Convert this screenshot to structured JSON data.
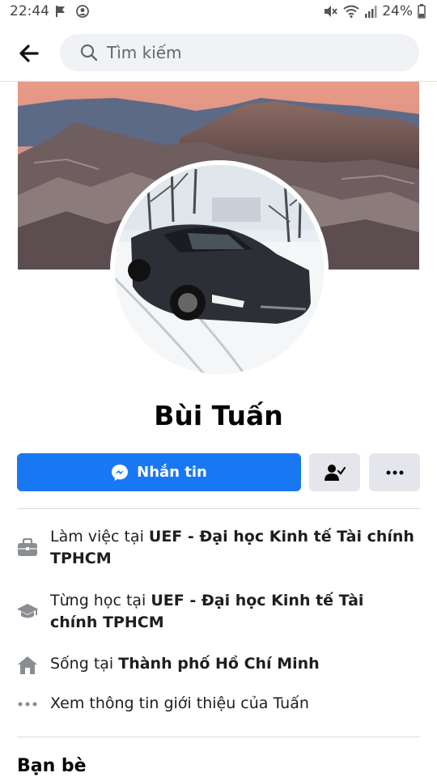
{
  "status_bar": {
    "time": "22:44",
    "battery": "24%"
  },
  "search": {
    "placeholder": "Tìm kiếm"
  },
  "profile": {
    "name": "Bùi Tuấn",
    "message_label": "Nhắn tin"
  },
  "intro": {
    "work_prefix": "Làm việc tại ",
    "work_place": "UEF - Đại học Kinh tế Tài chính TPHCM",
    "study_prefix": "Từng học tại ",
    "study_place": "UEF - Đại học Kinh tế Tài chính TPHCM",
    "live_prefix": "Sống tại ",
    "live_place": "Thành phố Hồ Chí Minh",
    "about_link": "Xem thông tin giới thiệu của Tuấn"
  },
  "friends": {
    "heading": "Bạn bè"
  },
  "icons": {
    "back": "arrow-left-icon",
    "search": "search-icon",
    "messenger": "messenger-icon",
    "friend": "friend-check-icon",
    "more": "more-horizontal-icon",
    "work": "briefcase-icon",
    "study": "graduation-cap-icon",
    "live": "home-icon",
    "about": "ellipsis-icon"
  },
  "colors": {
    "primary": "#1877f2",
    "secondary_button": "#e4e6eb"
  }
}
